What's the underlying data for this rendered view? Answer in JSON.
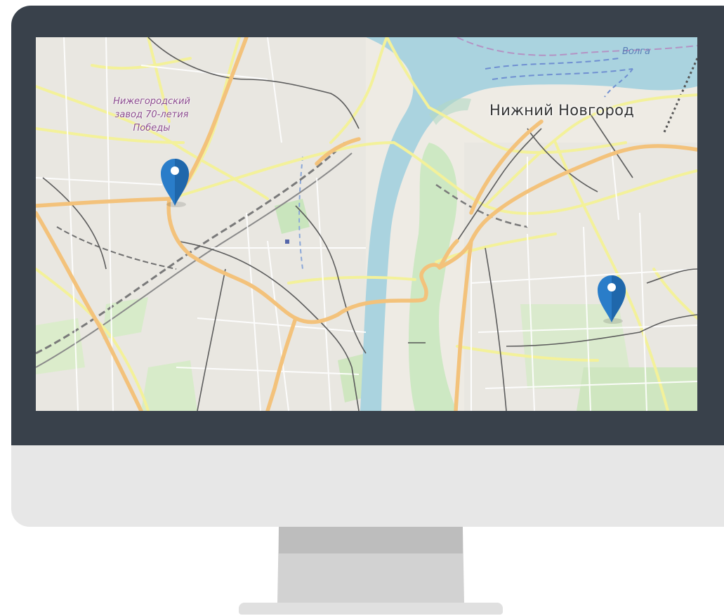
{
  "map": {
    "city_label": "Нижний Новгород",
    "river_label": "Волга",
    "poi_label": "Нижегородский завод 70-летия Победы",
    "markers": [
      {
        "name": "location-marker-west",
        "icon": "map-pin-icon",
        "color": "#2a7dc9"
      },
      {
        "name": "location-marker-east",
        "icon": "map-pin-icon",
        "color": "#2a7dc9"
      }
    ],
    "colors": {
      "water": "#aad3df",
      "land": "#f0ede6",
      "major_road": "#f7c98a",
      "secondary_road": "#f6f6a8",
      "marker": "#2a7dc9",
      "bezel": "#39414b"
    }
  }
}
